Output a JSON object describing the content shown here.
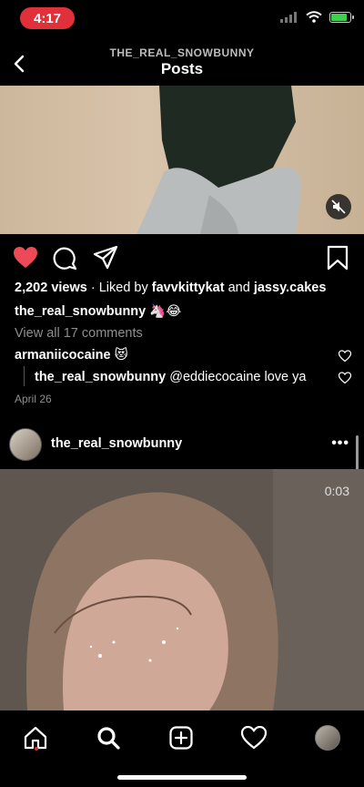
{
  "status_bar": {
    "time": "4:17",
    "icons": [
      "signal-icon",
      "wifi-icon",
      "battery-icon"
    ],
    "time_pill_color": "#e0303a",
    "battery_level": 0.75
  },
  "header": {
    "username": "THE_REAL_SNOWBUNNY",
    "title": "Posts",
    "back_icon": "chevron-left-icon"
  },
  "post1": {
    "liked": true,
    "views": "2,202 views",
    "separator": "·",
    "liked_by_prefix": "Liked by",
    "liked_by_user": "favvkittykat",
    "liked_by_and": "and",
    "liked_by_other": "jassy.cakes",
    "caption_user": "the_real_snowbunny",
    "caption_emoji": "🦄😂",
    "view_comments": "View all 17 comments",
    "comments": [
      {
        "user": "armaniicocaine",
        "text": "😻"
      },
      {
        "user": "the_real_snowbunny",
        "text": "@eddiecocaine love ya"
      }
    ],
    "date": "April 26",
    "like_color": "#ed4956"
  },
  "post2": {
    "username": "the_real_snowbunny",
    "more": "•••",
    "duration": "0:03"
  },
  "bottom_nav": {
    "items": [
      "home-icon",
      "search-icon",
      "new-post-icon",
      "activity-icon",
      "profile-avatar"
    ],
    "active": "search-icon"
  }
}
